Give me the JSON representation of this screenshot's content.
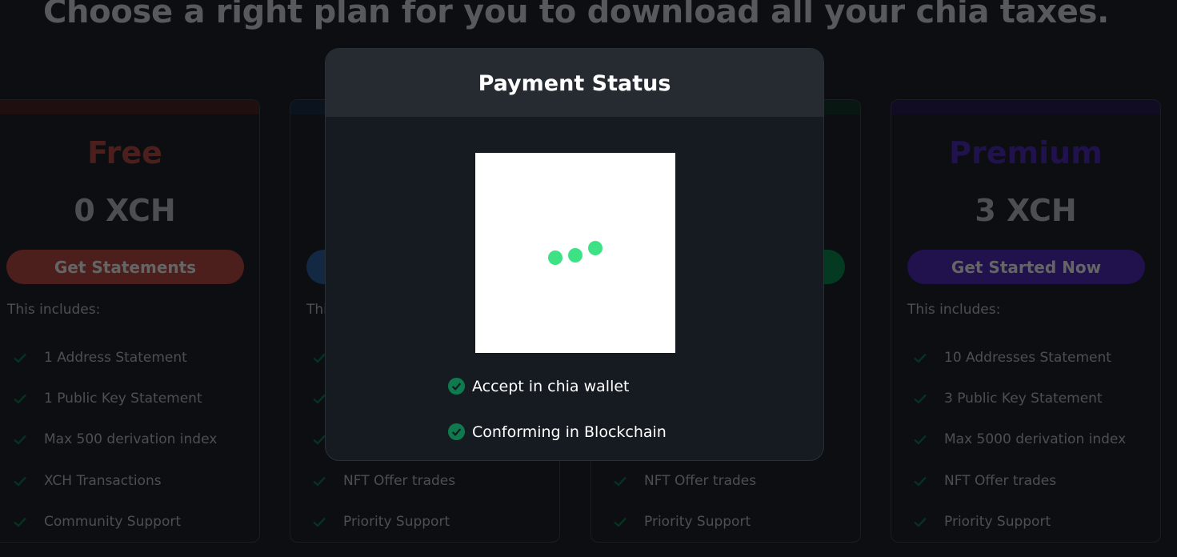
{
  "heading": "Choose a right plan for you to download all your chia taxes.",
  "colors": {
    "free": "#8b3a33",
    "free_bar": "#3a1c1c",
    "blue": "#244b7a",
    "blue_bar": "#15233a",
    "green": "#0a6a3e",
    "green_bar": "#0f2a22",
    "premium": "#3d1f8c",
    "premium_bar": "#1f1640",
    "check": "#0b5c3c",
    "status_check": "#0f7a4d"
  },
  "plans": [
    {
      "title": "Free",
      "price": "0 XCH",
      "button": "Get Statements",
      "includes": "This includes:",
      "features": [
        "1 Address Statement",
        "1 Public Key Statement",
        "Max 500 derivation index",
        "XCH Transactions",
        "Community Support"
      ]
    },
    {
      "title": "",
      "price": "",
      "button": "",
      "includes": "This includes:",
      "features": [
        "",
        "",
        "",
        "NFT Offer trades",
        "Priority Support"
      ]
    },
    {
      "title": "",
      "price": "",
      "button": "",
      "includes": "",
      "features": [
        "",
        "",
        "",
        "NFT Offer trades",
        "Priority Support"
      ]
    },
    {
      "title": "Premium",
      "price": "3 XCH",
      "button": "Get Started Now",
      "includes": "This includes:",
      "features": [
        "10 Addresses Statement",
        "3 Public Key Statement",
        "Max 5000 derivation index",
        "NFT Offer trades",
        "Priority Support"
      ]
    }
  ],
  "modal": {
    "title": "Payment Status",
    "steps": [
      "Accept in chia wallet",
      "Conforming in Blockchain"
    ]
  }
}
